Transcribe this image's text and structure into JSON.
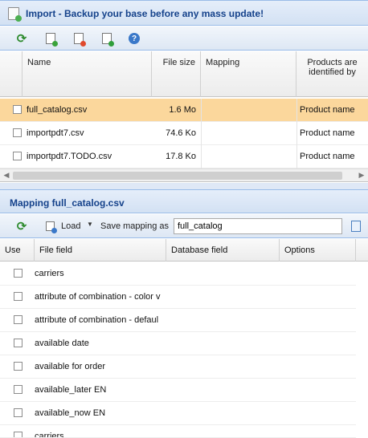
{
  "import_panel": {
    "title": "Import - Backup your base before any mass update!",
    "columns": [
      "Name",
      "File size",
      "Mapping",
      "Products are identified by"
    ],
    "files": [
      {
        "name": "full_catalog.csv",
        "size": "1.6 Mo",
        "mapping": "",
        "identified_by": "Product name",
        "selected": true
      },
      {
        "name": "importpdt7.csv",
        "size": "74.6 Ko",
        "mapping": "",
        "identified_by": "Product name",
        "selected": false
      },
      {
        "name": "importpdt7.TODO.csv",
        "size": "17.8 Ko",
        "mapping": "",
        "identified_by": "Product name",
        "selected": false
      }
    ]
  },
  "mapping_panel": {
    "title": "Mapping full_catalog.csv",
    "load_label": "Load",
    "save_mapping_label": "Save mapping as",
    "save_mapping_value": "full_catalog",
    "columns": [
      "Use",
      "File field",
      "Database field",
      "Options"
    ],
    "fields": [
      "carriers",
      "attribute of combination - color v",
      "attribute of combination - defaul",
      "available date",
      "available for order",
      "available_later EN",
      "available_now EN",
      "carriers"
    ]
  },
  "icons": {
    "toolbar": [
      "refresh-icon",
      "add-file-icon",
      "delete-file-icon",
      "import-icon",
      "help-icon"
    ],
    "mapping_toolbar": [
      "refresh-icon",
      "load-icon",
      "save-mapping-icon"
    ]
  },
  "colors": {
    "title_text": "#15428b",
    "selected_row": "#fbd79c",
    "panel_border": "#99bbe8"
  }
}
